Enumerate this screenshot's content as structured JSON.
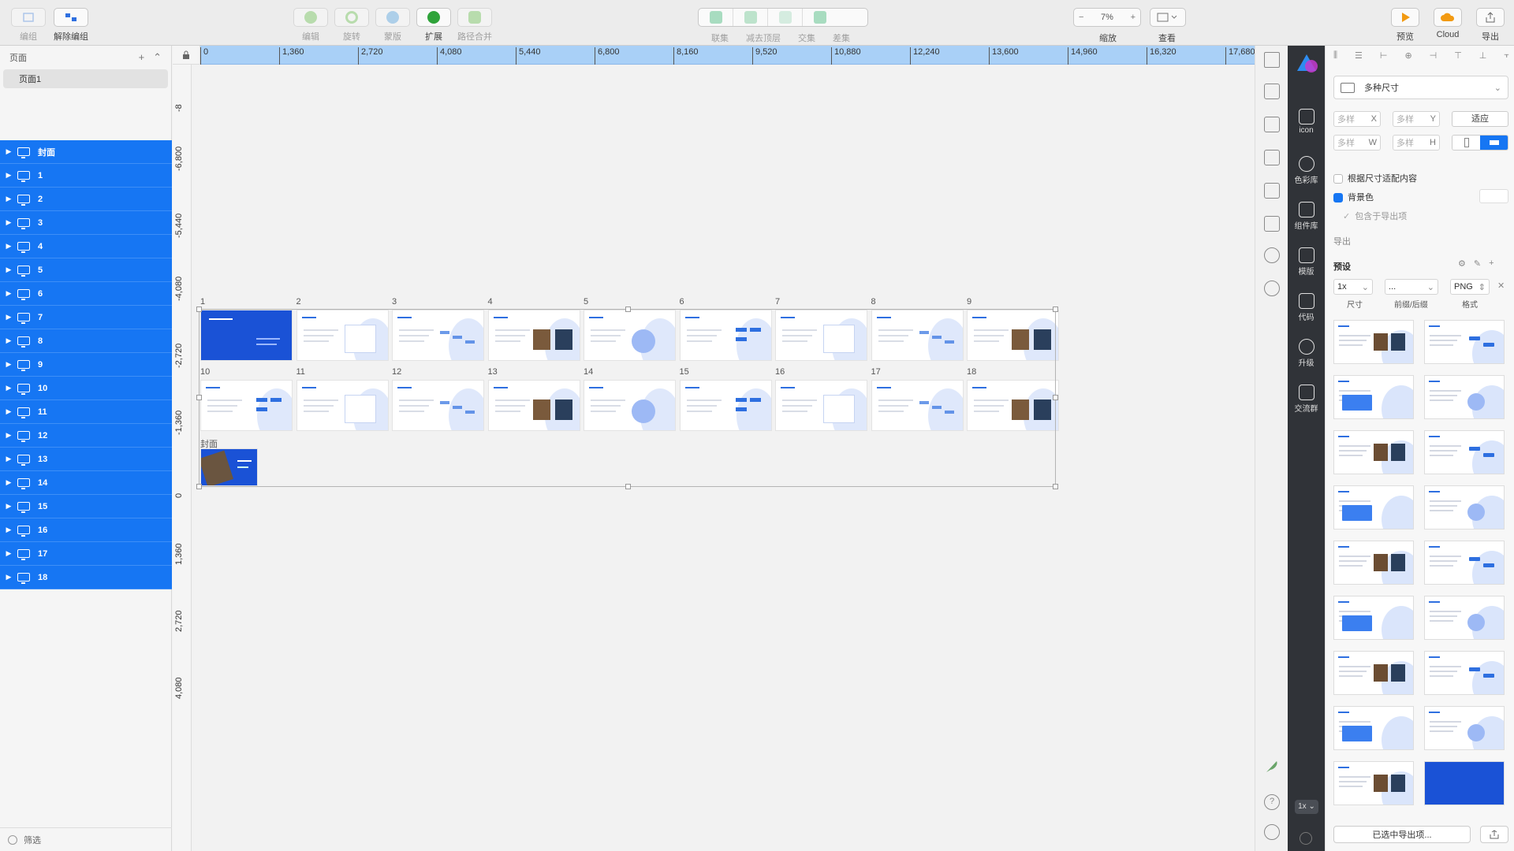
{
  "toolbar": {
    "group_label": "编组",
    "ungroup_label": "解除编组",
    "edit_label": "编辑",
    "rotate_label": "旋转",
    "mask_label": "蒙版",
    "expand_label": "扩展",
    "path_merge_label": "路径合并",
    "union_label": "联集",
    "subtract_label": "减去顶层",
    "intersect_label": "交集",
    "difference_label": "差集",
    "zoom_value": "7%",
    "zoom_label": "缩放",
    "view_label": "查看",
    "preview_label": "预览",
    "cloud_label": "Cloud",
    "export_label": "导出"
  },
  "sidebar": {
    "pages_header": "页面",
    "page_name": "页面1",
    "layers": [
      "封面",
      "1",
      "2",
      "3",
      "4",
      "5",
      "6",
      "7",
      "8",
      "9",
      "10",
      "11",
      "12",
      "13",
      "14",
      "15",
      "16",
      "17",
      "18"
    ],
    "filter_label": "筛选"
  },
  "ruler": {
    "h": [
      "0",
      "1,360",
      "2,720",
      "4,080",
      "5,440",
      "6,800",
      "8,160",
      "9,520",
      "10,880",
      "12,240",
      "13,600",
      "14,960",
      "16,320",
      "17,680"
    ],
    "v": [
      "-8",
      "-6,800",
      "-5,440",
      "-4,080",
      "-2,720",
      "-1,360",
      "0",
      "1,360",
      "2,720",
      "4,080"
    ]
  },
  "artboards": {
    "row1": [
      "1",
      "2",
      "3",
      "4",
      "5",
      "6",
      "7",
      "8",
      "9"
    ],
    "row2": [
      "10",
      "11",
      "12",
      "13",
      "14",
      "15",
      "16",
      "17",
      "18"
    ],
    "cover": "封面"
  },
  "darkbar": {
    "icon": "icon",
    "palette": "色彩库",
    "components": "组件库",
    "templates": "模版",
    "code": "代码",
    "upgrade": "升级",
    "community": "交流群",
    "scale": "1x"
  },
  "inspector": {
    "size_preset": "多种尺寸",
    "x_placeholder": "多样",
    "x_unit": "X",
    "y_placeholder": "多样",
    "y_unit": "Y",
    "fit_button": "适应",
    "w_placeholder": "多样",
    "w_unit": "W",
    "h_placeholder": "多样",
    "h_unit": "H",
    "fit_content": "根据尺寸适配内容",
    "bg_color": "背景色",
    "include_export": "包含于导出项",
    "export_header": "导出",
    "preset_label": "预设",
    "scale_value": "1x",
    "suffix_value": "...",
    "format_value": "PNG",
    "size_caption": "尺寸",
    "suffix_caption": "前缀/后缀",
    "format_caption": "格式",
    "export_selected": "已选中导出项..."
  },
  "colors": {
    "accent": "#1676f3",
    "ruler": "#a9d0f7",
    "dark": "#303338"
  }
}
